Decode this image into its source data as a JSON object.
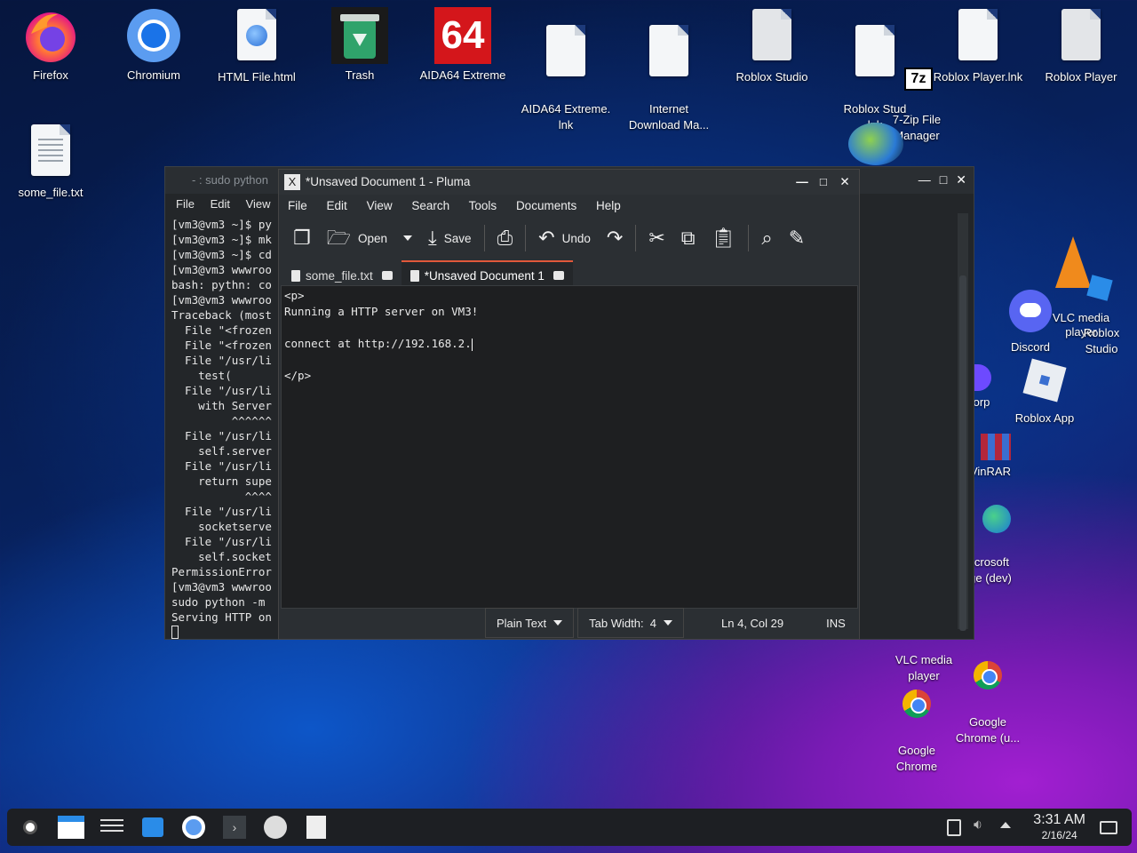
{
  "desktop_icons": [
    {
      "label": "Firefox"
    },
    {
      "label": "Chromium"
    },
    {
      "label": "HTML File.html"
    },
    {
      "label": "Trash"
    },
    {
      "label": "AIDA64 Extreme"
    },
    {
      "label": "AIDA64 Extreme.\nlnk"
    },
    {
      "label": "Internet\nDownload Ma..."
    },
    {
      "label": "Roblox Studio"
    },
    {
      "label": "Roblox Stud\nlnk"
    },
    {
      "label": "Roblox Player.lnk"
    },
    {
      "label": "Roblox Player"
    },
    {
      "label": "7-Zip File\nManager"
    },
    {
      "label": "some_file.txt"
    },
    {
      "label": "VLC media\nplayer"
    },
    {
      "label": "Roblox\nStudio"
    },
    {
      "label": "Discord"
    },
    {
      "label": "Roblox App"
    },
    {
      "label": "orp"
    },
    {
      "label": "VinRAR"
    },
    {
      "label": "icrosoft\nge (dev)"
    },
    {
      "label": "VLC media\nplayer"
    },
    {
      "label": "Google\nChrome (u..."
    },
    {
      "label": "Google\nChrome"
    }
  ],
  "aida_badge": "64",
  "sevenzip_badge": "7z",
  "terminal": {
    "title": "- : sudo python",
    "menu": [
      "File",
      "Edit",
      "View"
    ],
    "lines": [
      "[vm3@vm3 ~]$ py",
      "[vm3@vm3 ~]$ mk",
      "[vm3@vm3 ~]$ cd",
      "[vm3@vm3 wwwroo",
      "bash: pythn: co",
      "[vm3@vm3 wwwroo",
      "Traceback (most",
      "  File \"<frozen",
      "  File \"<frozen",
      "  File \"/usr/li",
      "    test(",
      "  File \"/usr/li",
      "    with Server",
      "         ^^^^^^",
      "  File \"/usr/li",
      "    self.server",
      "  File \"/usr/li",
      "    return supe",
      "           ^^^^",
      "  File \"/usr/li",
      "    socketserve",
      "  File \"/usr/li",
      "    self.socket",
      "PermissionError",
      "[vm3@vm3 wwwroo",
      "sudo python -m ",
      "Serving HTTP on"
    ]
  },
  "pluma": {
    "title": "*Unsaved Document 1 - Pluma",
    "logo": "X",
    "menu": [
      "File",
      "Edit",
      "View",
      "Search",
      "Tools",
      "Documents",
      "Help"
    ],
    "toolbar": {
      "open": "Open",
      "save": "Save",
      "undo": "Undo"
    },
    "tabs": [
      {
        "label": "some_file.txt"
      },
      {
        "label": "*Unsaved Document 1"
      }
    ],
    "editor_lines": [
      "<p>",
      "Running a HTTP server on VM3!",
      "",
      "connect at http://192.168.2.",
      "",
      "</p>"
    ],
    "status": {
      "syntax": "Plain Text",
      "tab_width": "Tab Width:  4",
      "position": "Ln 4, Col 29",
      "mode": "INS"
    }
  },
  "taskbar": {
    "time": "3:31 AM",
    "date": "2/16/24"
  }
}
